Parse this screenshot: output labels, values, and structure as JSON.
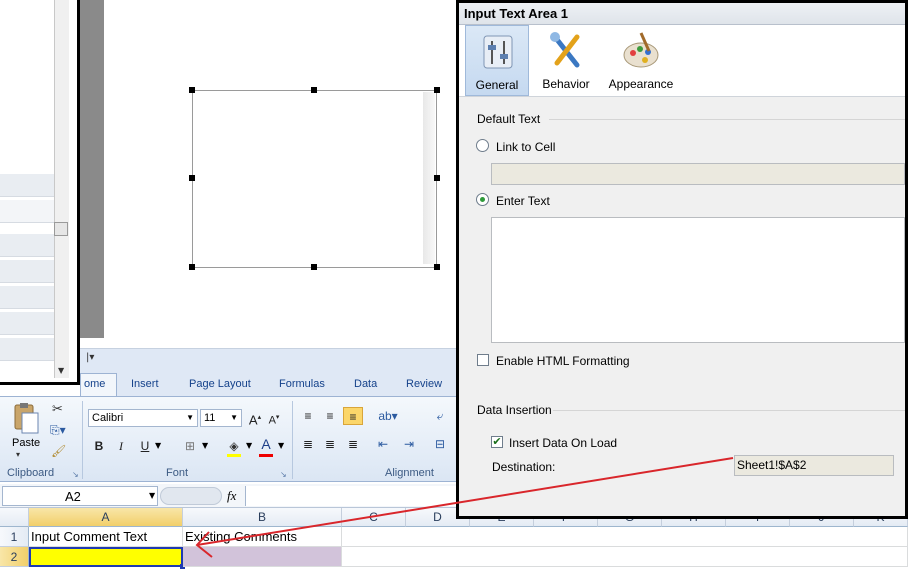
{
  "dialog": {
    "title": "Input Text Area 1",
    "tabs": [
      {
        "label": "General",
        "icon": "general-sliders-icon",
        "selected": true
      },
      {
        "label": "Behavior",
        "icon": "behavior-tools-icon",
        "selected": false
      },
      {
        "label": "Appearance",
        "icon": "appearance-palette-icon",
        "selected": false
      }
    ],
    "default_text": {
      "section_label": "Default Text",
      "link_to_cell_label": "Link to Cell",
      "link_to_cell_value": "",
      "enter_text_label": "Enter Text",
      "enter_text_value": "",
      "selected_option": "Enter Text"
    },
    "enable_html_label": "Enable HTML Formatting",
    "enable_html_checked": false,
    "data_insertion": {
      "section_label": "Data Insertion",
      "insert_on_load_label": "Insert Data On Load",
      "insert_on_load_checked": true,
      "destination_label": "Destination:",
      "destination_value": "Sheet1!$A$2"
    }
  },
  "excel": {
    "tabs": [
      "ome",
      "Insert",
      "Page Layout",
      "Formulas",
      "Data",
      "Review"
    ],
    "active_tab": "ome",
    "clipboard": {
      "paste_label": "Paste",
      "group_label": "Clipboard"
    },
    "font": {
      "name": "Calibri",
      "size": "11",
      "group_label": "Font",
      "bold": "B",
      "italic": "I",
      "underline": "U"
    },
    "alignment": {
      "group_label": "Alignment"
    },
    "name_box": "A2",
    "fx_label": "fx",
    "columns": [
      "A",
      "B",
      "C",
      "D",
      "E",
      "F",
      "G",
      "H",
      "I",
      "J",
      "K"
    ],
    "rows": [
      "1",
      "2"
    ],
    "cells": {
      "A1": "Input Comment Text",
      "B1": "Existing Comments",
      "A2": "",
      "B2": ""
    },
    "colors": {
      "A2_fill": "#ffff00",
      "A2_border": "#1f3bb0",
      "B2_fill": "#d2c3da"
    }
  },
  "annotation": {
    "arrow_color": "#d9262b"
  }
}
